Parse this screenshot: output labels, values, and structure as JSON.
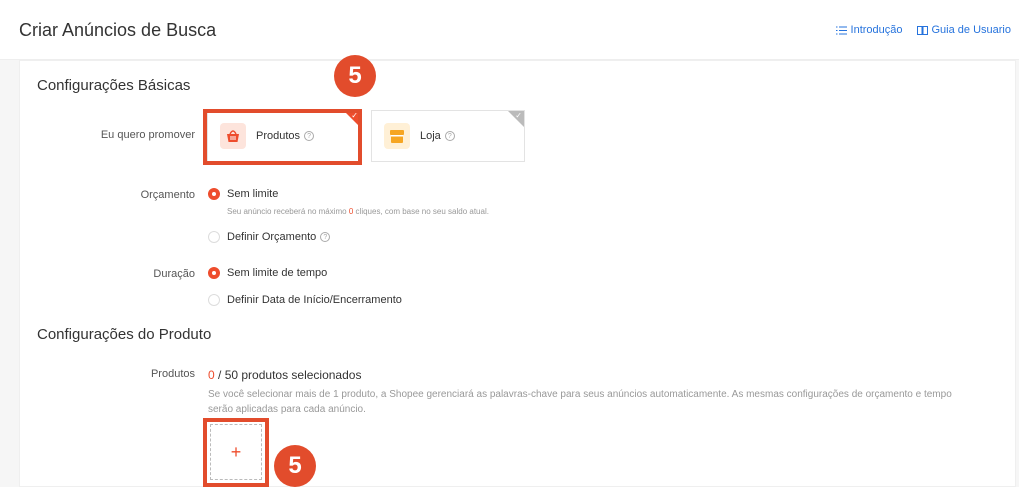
{
  "header": {
    "title": "Criar Anúncios de Busca",
    "links": [
      {
        "label": "Introdução",
        "icon": "list-icon"
      },
      {
        "label": "Guia de Usuario",
        "icon": "book-icon"
      }
    ]
  },
  "basic": {
    "title": "Configurações Básicas",
    "promote_label": "Eu quero promover",
    "options": [
      {
        "label": "Produtos",
        "icon": "basket-icon",
        "selected": true
      },
      {
        "label": "Loja",
        "icon": "shop-icon",
        "selected": false
      }
    ],
    "budget_label": "Orçamento",
    "budget_options": [
      {
        "label": "Sem limite",
        "selected": true
      },
      {
        "label": "Definir Orçamento",
        "selected": false
      }
    ],
    "budget_hint_pre": "Seu anúncio receberá no máximo ",
    "budget_hint_num": "0",
    "budget_hint_post": " cliques, com base no seu saldo atual.",
    "duration_label": "Duração",
    "duration_options": [
      {
        "label": "Sem limite de tempo",
        "selected": true
      },
      {
        "label": "Definir Data de Início/Encerramento",
        "selected": false
      }
    ]
  },
  "product": {
    "title": "Configurações do Produto",
    "label": "Produtos",
    "count": "0",
    "count_suffix": " / 50 produtos selecionados",
    "desc": "Se você selecionar mais de 1 produto, a Shopee gerenciará as palavras-chave para seus anúncios automaticamente. As mesmas configurações de orçamento e tempo serão aplicadas para cada anúncio.",
    "add_symbol": "+"
  },
  "annotations": {
    "step": "5"
  },
  "colors": {
    "accent": "#ee4d2d",
    "highlight": "#e24c2c",
    "link": "#2673dd"
  }
}
